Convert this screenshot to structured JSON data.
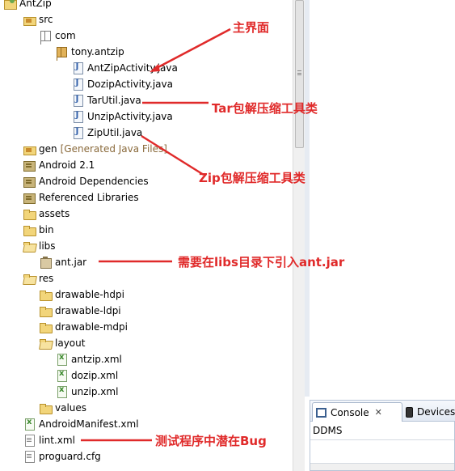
{
  "tree": [
    {
      "label": "AntZip",
      "icon": "project-icon",
      "decor": ""
    },
    {
      "label": "src",
      "icon": "source-folder-icon",
      "decor": ""
    },
    {
      "label": "com",
      "icon": "empty-package-icon",
      "decor": ""
    },
    {
      "label": "tony.antzip",
      "icon": "package-icon",
      "decor": ""
    },
    {
      "label": "AntZipActivity.java",
      "icon": "java-file-icon",
      "decor": ""
    },
    {
      "label": "DozipActivity.java",
      "icon": "java-file-icon",
      "decor": ""
    },
    {
      "label": "TarUtil.java",
      "icon": "java-file-icon",
      "decor": ""
    },
    {
      "label": "UnzipActivity.java",
      "icon": "java-file-icon",
      "decor": ""
    },
    {
      "label": "ZipUtil.java",
      "icon": "java-file-icon",
      "decor": ""
    },
    {
      "label": "gen",
      "icon": "source-folder-icon",
      "decor": "[Generated Java Files]"
    },
    {
      "label": "Android 2.1",
      "icon": "library-icon",
      "decor": ""
    },
    {
      "label": "Android Dependencies",
      "icon": "library-icon",
      "decor": ""
    },
    {
      "label": "Referenced Libraries",
      "icon": "library-icon",
      "decor": ""
    },
    {
      "label": "assets",
      "icon": "folder-icon",
      "decor": ""
    },
    {
      "label": "bin",
      "icon": "folder-icon",
      "decor": ""
    },
    {
      "label": "libs",
      "icon": "folder-open-icon",
      "decor": ""
    },
    {
      "label": "ant.jar",
      "icon": "jar-file-icon",
      "decor": ""
    },
    {
      "label": "res",
      "icon": "folder-open-icon",
      "decor": ""
    },
    {
      "label": "drawable-hdpi",
      "icon": "folder-icon",
      "decor": ""
    },
    {
      "label": "drawable-ldpi",
      "icon": "folder-icon",
      "decor": ""
    },
    {
      "label": "drawable-mdpi",
      "icon": "folder-icon",
      "decor": ""
    },
    {
      "label": "layout",
      "icon": "folder-open-icon",
      "decor": ""
    },
    {
      "label": "antzip.xml",
      "icon": "xml-file-icon",
      "decor": ""
    },
    {
      "label": "dozip.xml",
      "icon": "xml-file-icon",
      "decor": ""
    },
    {
      "label": "unzip.xml",
      "icon": "xml-file-icon",
      "decor": ""
    },
    {
      "label": "values",
      "icon": "folder-icon",
      "decor": ""
    },
    {
      "label": "AndroidManifest.xml",
      "icon": "xml-file-icon",
      "decor": ""
    },
    {
      "label": "lint.xml",
      "icon": "file-icon",
      "decor": ""
    },
    {
      "label": "proguard.cfg",
      "icon": "file-icon",
      "decor": ""
    }
  ],
  "annotations": {
    "main_ui": "主界面",
    "tar_util": "Tar包解压缩工具类",
    "zip_util": "Zip包解压缩工具类",
    "ant_jar": "需要在libs目录下引入ant.jar",
    "lint_bug": "测试程序中潜在Bug"
  },
  "bottom_panel": {
    "console_tab": "Console",
    "close_glyph": "✕",
    "devices_tab": "Devices",
    "console_text": "DDMS"
  },
  "colors": {
    "annotation": "#e02a2a"
  }
}
